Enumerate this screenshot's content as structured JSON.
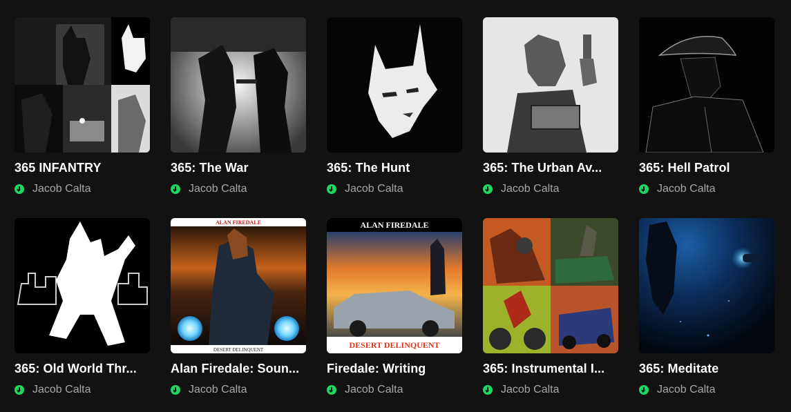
{
  "playlists": [
    {
      "title": "365 INFANTRY",
      "artist": "Jacob Calta",
      "cover_icon": "collage-bw-art",
      "accent": "#ffffff"
    },
    {
      "title": "365: The War",
      "artist": "Jacob Calta",
      "cover_icon": "two-figures-bw-art",
      "accent": "#cfcfcf"
    },
    {
      "title": "365: The Hunt",
      "artist": "Jacob Calta",
      "cover_icon": "wolf-face-bw-art",
      "accent": "#e8e8e8"
    },
    {
      "title": "365: The Urban Av...",
      "artist": "Jacob Calta",
      "cover_icon": "mugshot-sketch-art",
      "accent": "#bdbdbd"
    },
    {
      "title": "365: Hell Patrol",
      "artist": "Jacob Calta",
      "cover_icon": "silhouette-hat-art",
      "accent": "#555555"
    },
    {
      "title": "365: Old World Thr...",
      "artist": "Jacob Calta",
      "cover_icon": "white-silhouette-art",
      "accent": "#ffffff"
    },
    {
      "title": "Alan Firedale: Soun...",
      "artist": "Jacob Calta",
      "cover_icon": "alan-firedale-art",
      "accent": "#e07b1f",
      "cover_top_text": "ALAN FIREDALE",
      "cover_bottom_text": "DESERT DELINQUENT"
    },
    {
      "title": "Firedale: Writing",
      "artist": "Jacob Calta",
      "cover_icon": "desert-delinquent-art",
      "accent": "#d9351e",
      "cover_top_text": "ALAN FIREDALE",
      "cover_bottom_text": "DESERT DELINQUENT"
    },
    {
      "title": "365: Instrumental I...",
      "artist": "Jacob Calta",
      "cover_icon": "color-collage-art",
      "accent": "#d8782c"
    },
    {
      "title": "365: Meditate",
      "artist": "Jacob Calta",
      "cover_icon": "deep-sea-art",
      "accent": "#0f4a8a"
    }
  ],
  "colors": {
    "background": "#121212",
    "download_green": "#1ed760",
    "subtext": "#a7a7a7"
  }
}
